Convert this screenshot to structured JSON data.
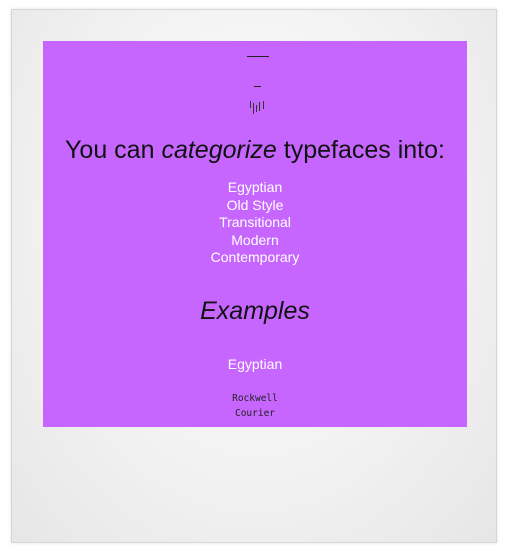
{
  "slide": {
    "heading": {
      "before": "You can ",
      "emphasis": "categorize",
      "after": " typefaces into:"
    },
    "categories": [
      "Egyptian",
      "Old Style",
      "Transitional",
      "Modern",
      "Contemporary"
    ],
    "examples_title": "Examples",
    "example_category": "Egyptian",
    "example_fonts": [
      "Rockwell",
      "Courier"
    ]
  },
  "colors": {
    "slide_background": "#c666ff",
    "list_text": "#ffffff",
    "heading_text": "#111111",
    "frame_background": "#f2f2f2"
  }
}
